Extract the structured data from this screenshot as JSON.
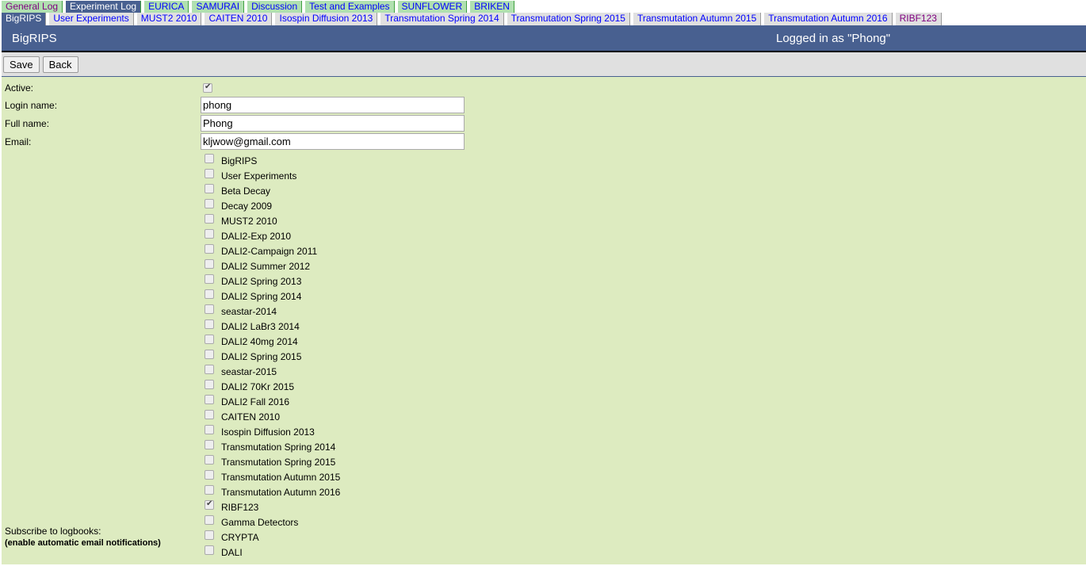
{
  "top_tabs": [
    {
      "label": "General Log",
      "state": "visited"
    },
    {
      "label": "Experiment Log",
      "state": "selected"
    },
    {
      "label": "EURICA",
      "state": ""
    },
    {
      "label": "SAMURAI",
      "state": ""
    },
    {
      "label": "Discussion",
      "state": ""
    },
    {
      "label": "Test and Examples",
      "state": ""
    },
    {
      "label": "SUNFLOWER",
      "state": ""
    },
    {
      "label": "BRIKEN",
      "state": ""
    }
  ],
  "sub_tabs": [
    {
      "label": "BigRIPS",
      "state": "selected"
    },
    {
      "label": "User Experiments",
      "state": ""
    },
    {
      "label": "MUST2 2010",
      "state": ""
    },
    {
      "label": "CAITEN 2010",
      "state": ""
    },
    {
      "label": "Isospin Diffusion 2013",
      "state": ""
    },
    {
      "label": "Transmutation Spring 2014",
      "state": ""
    },
    {
      "label": "Transmutation Spring 2015",
      "state": ""
    },
    {
      "label": "Transmutation Autumn 2015",
      "state": ""
    },
    {
      "label": "Transmutation Autumn 2016",
      "state": ""
    },
    {
      "label": "RIBF123",
      "state": "visited"
    }
  ],
  "header": {
    "title": "BigRIPS",
    "login": "Logged in as \"Phong\""
  },
  "toolbar": {
    "save": "Save",
    "back": "Back"
  },
  "form": {
    "active_label": "Active:",
    "active": true,
    "login_label": "Login name:",
    "login_value": "phong",
    "fullname_label": "Full name:",
    "fullname_value": "Phong",
    "email_label": "Email:",
    "email_value": "kljwow@gmail.com",
    "subscribe_label": "Subscribe to logbooks:",
    "subscribe_note": "(enable automatic email notifications)"
  },
  "logbooks": [
    {
      "label": "BigRIPS",
      "checked": false
    },
    {
      "label": "User Experiments",
      "checked": false
    },
    {
      "label": "Beta Decay",
      "checked": false
    },
    {
      "label": "Decay 2009",
      "checked": false
    },
    {
      "label": "MUST2 2010",
      "checked": false
    },
    {
      "label": "DALI2-Exp 2010",
      "checked": false
    },
    {
      "label": "DALI2-Campaign 2011",
      "checked": false
    },
    {
      "label": "DALI2 Summer 2012",
      "checked": false
    },
    {
      "label": "DALI2 Spring 2013",
      "checked": false
    },
    {
      "label": "DALI2 Spring 2014",
      "checked": false
    },
    {
      "label": "seastar-2014",
      "checked": false
    },
    {
      "label": "DALI2 LaBr3 2014",
      "checked": false
    },
    {
      "label": "DALI2 40mg 2014",
      "checked": false
    },
    {
      "label": "DALI2 Spring 2015",
      "checked": false
    },
    {
      "label": "seastar-2015",
      "checked": false
    },
    {
      "label": "DALI2 70Kr 2015",
      "checked": false
    },
    {
      "label": "DALI2 Fall 2016",
      "checked": false
    },
    {
      "label": "CAITEN 2010",
      "checked": false
    },
    {
      "label": "Isospin Diffusion 2013",
      "checked": false
    },
    {
      "label": "Transmutation Spring 2014",
      "checked": false
    },
    {
      "label": "Transmutation Spring 2015",
      "checked": false
    },
    {
      "label": "Transmutation Autumn 2015",
      "checked": false
    },
    {
      "label": "Transmutation Autumn 2016",
      "checked": false
    },
    {
      "label": "RIBF123",
      "checked": true
    },
    {
      "label": "Gamma Detectors",
      "checked": false
    },
    {
      "label": "CRYPTA",
      "checked": false
    },
    {
      "label": "DALI",
      "checked": false
    }
  ]
}
